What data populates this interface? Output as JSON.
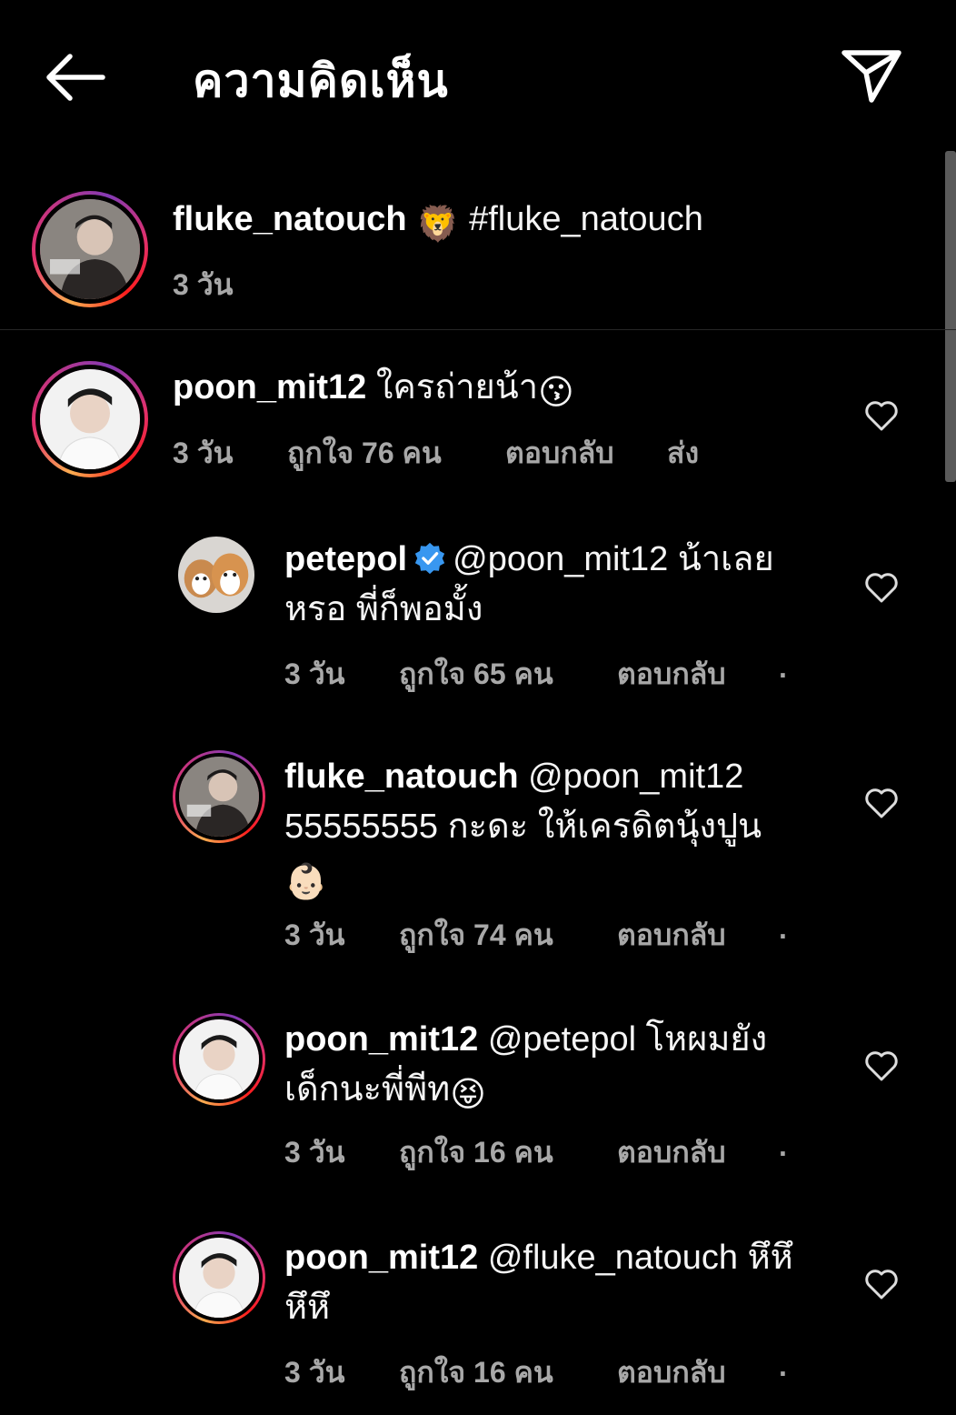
{
  "header": {
    "title": "ความคิดเห็น"
  },
  "caption": {
    "username": "fluke_natouch",
    "emoji": "🦁",
    "text": "#fluke_natouch",
    "time": "3 วัน"
  },
  "comments": [
    {
      "username": "poon_mit12",
      "text": "ใครถ่ายน้า",
      "emoji": "😗",
      "time": "3 วัน",
      "likes": "ถูกใจ 76 คน",
      "reply": "ตอบกลับ",
      "send": "ส่ง"
    }
  ],
  "replies": [
    {
      "username": "petepol",
      "verified": true,
      "text_line1": "@poon_mit12 น้าเลย",
      "text_line2": "หรอ พี่ก็พอมั้ง",
      "time": "3 วัน",
      "likes": "ถูกใจ 65 คน",
      "reply": "ตอบกลับ",
      "more": "."
    },
    {
      "username": "fluke_natouch",
      "text_line1": "@poon_mit12",
      "text_line2": "55555555 กะดะ ให้เครดิตนุ้งปูน",
      "emoji": "👶🏻",
      "time": "3 วัน",
      "likes": "ถูกใจ 74 คน",
      "reply": "ตอบกลับ",
      "more": "."
    },
    {
      "username": "poon_mit12",
      "text_line1": "@petepol โหผมยัง",
      "text_line2": "เด็กนะพี่พีท",
      "emoji": "😝",
      "time": "3 วัน",
      "likes": "ถูกใจ 16 คน",
      "reply": "ตอบกลับ",
      "more": "."
    },
    {
      "username": "poon_mit12",
      "text_line1": "@fluke_natouch หึหึ",
      "text_line2": "หึหึ",
      "time": "3 วัน",
      "likes": "ถูกใจ 16 คน",
      "reply": "ตอบกลับ",
      "more": "."
    }
  ],
  "colors": {
    "background": "#000000",
    "secondary_text": "#a8a8a8",
    "verified": "#3897f0"
  },
  "icons": [
    "back-arrow-icon",
    "send-icon",
    "heart-icon",
    "verified-badge-icon"
  ]
}
